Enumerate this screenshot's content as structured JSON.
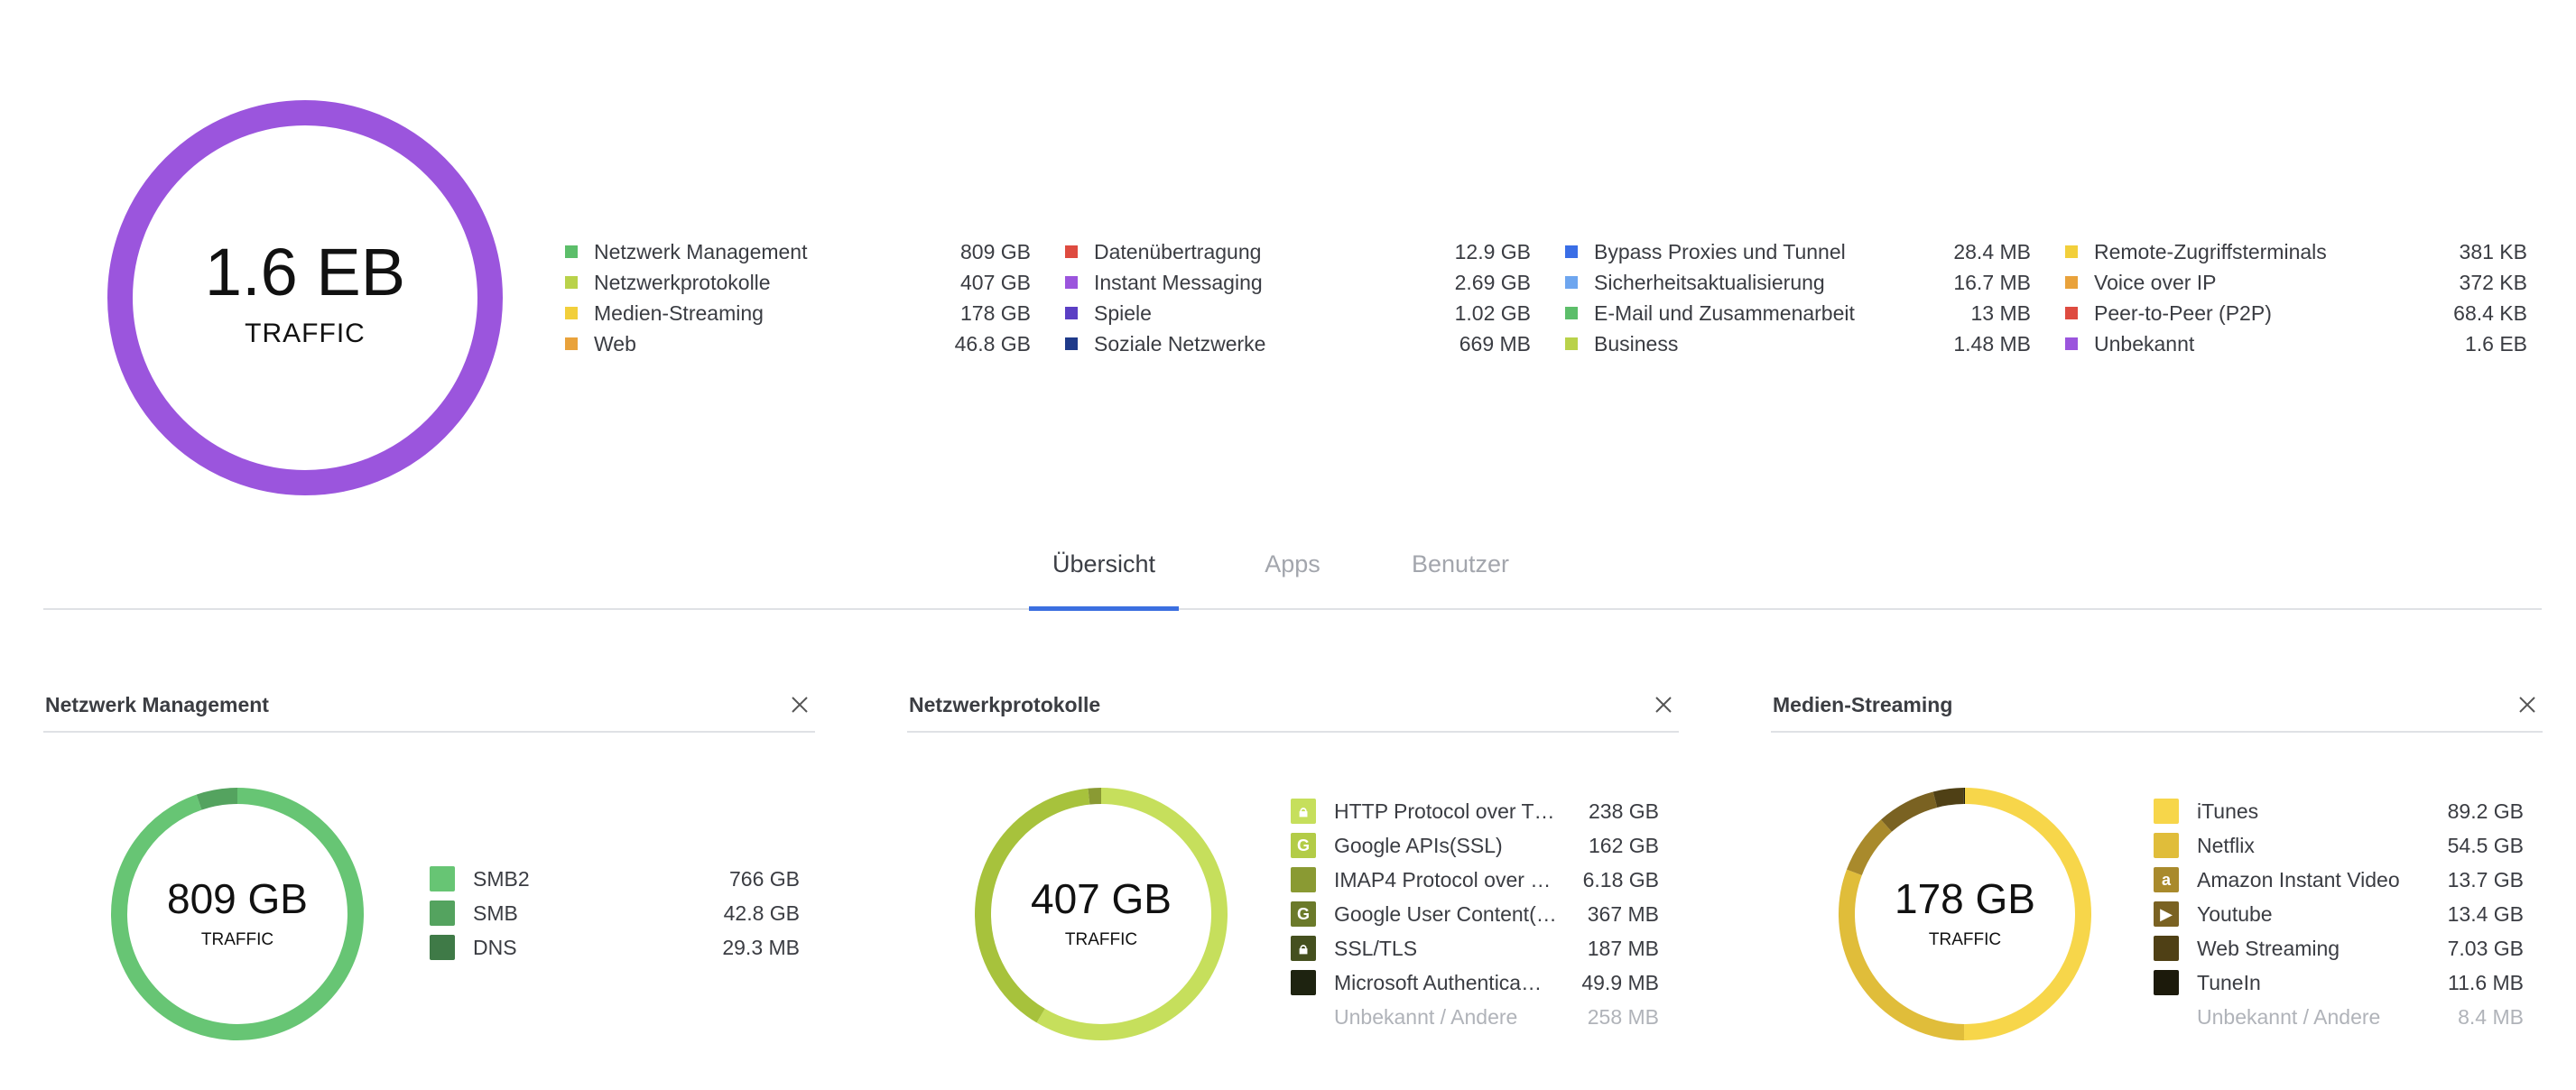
{
  "summary": {
    "total_value": "1.6 EB",
    "total_label": "TRAFFIC",
    "ring_color": "#9b55dd",
    "legend_columns": [
      [
        {
          "label": "Netzwerk Management",
          "value": "809 GB",
          "color": "#5cbe6a"
        },
        {
          "label": "Netzwerkprotokolle",
          "value": "407 GB",
          "color": "#b9d24a"
        },
        {
          "label": "Medien-Streaming",
          "value": "178 GB",
          "color": "#f2cf3b"
        },
        {
          "label": "Web",
          "value": "46.8 GB",
          "color": "#e9a23b"
        }
      ],
      [
        {
          "label": "Datenübertragung",
          "value": "12.9 GB",
          "color": "#de4b40"
        },
        {
          "label": "Instant Messaging",
          "value": "2.69 GB",
          "color": "#9b55dd"
        },
        {
          "label": "Spiele",
          "value": "1.02 GB",
          "color": "#5b3fc4"
        },
        {
          "label": "Soziale Netzwerke",
          "value": "669 MB",
          "color": "#1f3a8a"
        }
      ],
      [
        {
          "label": "Bypass Proxies und Tunnel",
          "value": "28.4 MB",
          "color": "#3a6ee6"
        },
        {
          "label": "Sicherheitsaktualisierung",
          "value": "16.7 MB",
          "color": "#6ea6ef"
        },
        {
          "label": "E-Mail und Zusammenarbeit",
          "value": "13 MB",
          "color": "#5cbe6a"
        },
        {
          "label": "Business",
          "value": "1.48 MB",
          "color": "#b9d24a"
        }
      ],
      [
        {
          "label": "Remote-Zugriffsterminals",
          "value": "381 KB",
          "color": "#f2cf3b"
        },
        {
          "label": "Voice over IP",
          "value": "372 KB",
          "color": "#e9a23b"
        },
        {
          "label": "Peer-to-Peer (P2P)",
          "value": "68.4 KB",
          "color": "#de4b40"
        },
        {
          "label": "Unbekannt",
          "value": "1.6 EB",
          "color": "#9b55dd"
        }
      ]
    ]
  },
  "tabs": [
    {
      "label": "Übersicht",
      "active": true
    },
    {
      "label": "Apps",
      "active": false
    },
    {
      "label": "Benutzer",
      "active": false
    }
  ],
  "cards": [
    {
      "title": "Netzwerk Management",
      "total": "809 GB",
      "total_label": "TRAFFIC",
      "segments": [
        {
          "fraction": 0.947,
          "color": "#67c574"
        },
        {
          "fraction": 0.053,
          "color": "#54a35f"
        }
      ],
      "items": [
        {
          "label": "SMB2",
          "value": "766 GB",
          "color": "#67c574",
          "icon": "square"
        },
        {
          "label": "SMB",
          "value": "42.8 GB",
          "color": "#54a35f",
          "icon": "square"
        },
        {
          "label": "DNS",
          "value": "29.3 MB",
          "color": "#3f7a47",
          "icon": "square"
        }
      ]
    },
    {
      "title": "Netzwerkprotokolle",
      "total": "407 GB",
      "total_label": "TRAFFIC",
      "segments": [
        {
          "fraction": 0.585,
          "color": "#c6df5c"
        },
        {
          "fraction": 0.398,
          "color": "#a7c23c"
        },
        {
          "fraction": 0.017,
          "color": "#8a9a33"
        }
      ],
      "items": [
        {
          "label": "HTTP Protocol over T…",
          "value": "238 GB",
          "color": "#c6df5c",
          "icon": "lock-icon"
        },
        {
          "label": "Google APIs(SSL)",
          "value": "162 GB",
          "color": "#b3cc47",
          "icon": "google-icon"
        },
        {
          "label": "IMAP4 Protocol over …",
          "value": "6.18 GB",
          "color": "#8a9a33",
          "icon": "square"
        },
        {
          "label": "Google User Content(…",
          "value": "367 MB",
          "color": "#6b7a2a",
          "icon": "google-icon"
        },
        {
          "label": "SSL/TLS",
          "value": "187 MB",
          "color": "#45501f",
          "icon": "lock-icon"
        },
        {
          "label": "Microsoft Authentica…",
          "value": "49.9 MB",
          "color": "#1e2310",
          "icon": "square"
        },
        {
          "label": "Unbekannt / Andere",
          "value": "258 MB",
          "color": "",
          "icon": "none",
          "muted": true
        }
      ]
    },
    {
      "title": "Medien-Streaming",
      "total": "178 GB",
      "total_label": "TRAFFIC",
      "segments": [
        {
          "fraction": 0.501,
          "color": "#f7d64a"
        },
        {
          "fraction": 0.306,
          "color": "#e0bd3a"
        },
        {
          "fraction": 0.077,
          "color": "#a98a2c"
        },
        {
          "fraction": 0.075,
          "color": "#7a6222"
        },
        {
          "fraction": 0.039,
          "color": "#4f4015"
        },
        {
          "fraction": 0.002,
          "color": "#22200c"
        }
      ],
      "items": [
        {
          "label": "iTunes",
          "value": "89.2 GB",
          "color": "#f7d64a",
          "icon": "apple-icon"
        },
        {
          "label": "Netflix",
          "value": "54.5 GB",
          "color": "#e0bd3a",
          "icon": "square"
        },
        {
          "label": "Amazon Instant Video",
          "value": "13.7 GB",
          "color": "#a98a2c",
          "icon": "amazon-icon"
        },
        {
          "label": "Youtube",
          "value": "13.4 GB",
          "color": "#7a6222",
          "icon": "youtube-icon"
        },
        {
          "label": "Web Streaming",
          "value": "7.03 GB",
          "color": "#4f4015",
          "icon": "square"
        },
        {
          "label": "TuneIn",
          "value": "11.6 MB",
          "color": "#1c1a0b",
          "icon": "square"
        },
        {
          "label": "Unbekannt / Andere",
          "value": "8.4 MB",
          "color": "",
          "icon": "none",
          "muted": true
        }
      ]
    }
  ]
}
